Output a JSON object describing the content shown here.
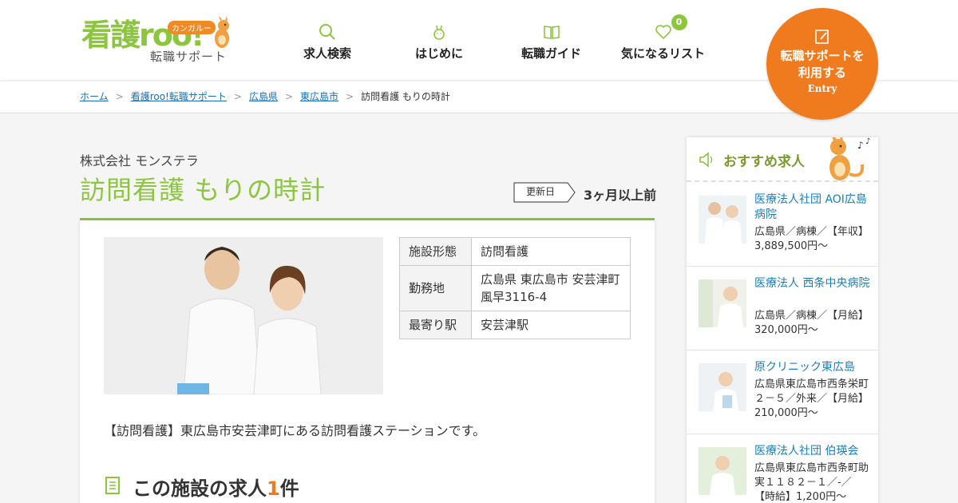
{
  "header": {
    "logo_main": "看護roo!",
    "logo_sub": "転職サポート",
    "logo_badge": "カンガルー",
    "nav": [
      {
        "label": "求人検索",
        "icon": "search-icon"
      },
      {
        "label": "はじめに",
        "icon": "kangaroo-icon"
      },
      {
        "label": "転職ガイド",
        "icon": "book-icon"
      },
      {
        "label": "気になるリスト",
        "icon": "heart-icon",
        "badge": "0"
      }
    ],
    "entry": {
      "line1": "転職サポートを",
      "line2": "利用する",
      "en": "Entry"
    }
  },
  "breadcrumb": {
    "links": [
      "ホーム",
      "看護roo!転職サポート",
      "広島県",
      "東広島市"
    ],
    "current": "訪問看護 もりの時計",
    "separator": ">"
  },
  "facility": {
    "company": "株式会社 モンステラ",
    "title": "訪問看護 もりの時計",
    "updated_label": "更新日",
    "updated_value": "3ヶ月以上前",
    "info": [
      {
        "key": "施設形態",
        "value": "訪問看護"
      },
      {
        "key": "勤務地",
        "value": "広島県 東広島市 安芸津町風早3116-4"
      },
      {
        "key": "最寄り駅",
        "value": "安芸津駅"
      }
    ],
    "description": "【訪問看護】東広島市安芸津町にある訪問看護ステーションです。",
    "jobs_prefix": "この施設の求人",
    "jobs_count": "1",
    "jobs_suffix": "件"
  },
  "sidebar": {
    "title": "おすすめ求人",
    "items": [
      {
        "name": "医療法人社団 AOI広島病院",
        "detail": "広島県／病棟／【年収】3,889,500円〜"
      },
      {
        "name": "医療法人 西条中央病院",
        "detail": "広島県／病棟／【月給】320,000円〜"
      },
      {
        "name": "原クリニック東広島",
        "detail": "広島県東広島市西条栄町２－５／外来／【月給】210,000円〜"
      },
      {
        "name": "医療法人社団 伯瑛会",
        "detail": "広島県東広島市西条町助実１１８２－１／-／【時給】1,200円〜"
      }
    ]
  },
  "colors": {
    "brand_green": "#8cc63f",
    "accent_orange": "#f07b1e",
    "link_blue": "#1a6fb3"
  }
}
